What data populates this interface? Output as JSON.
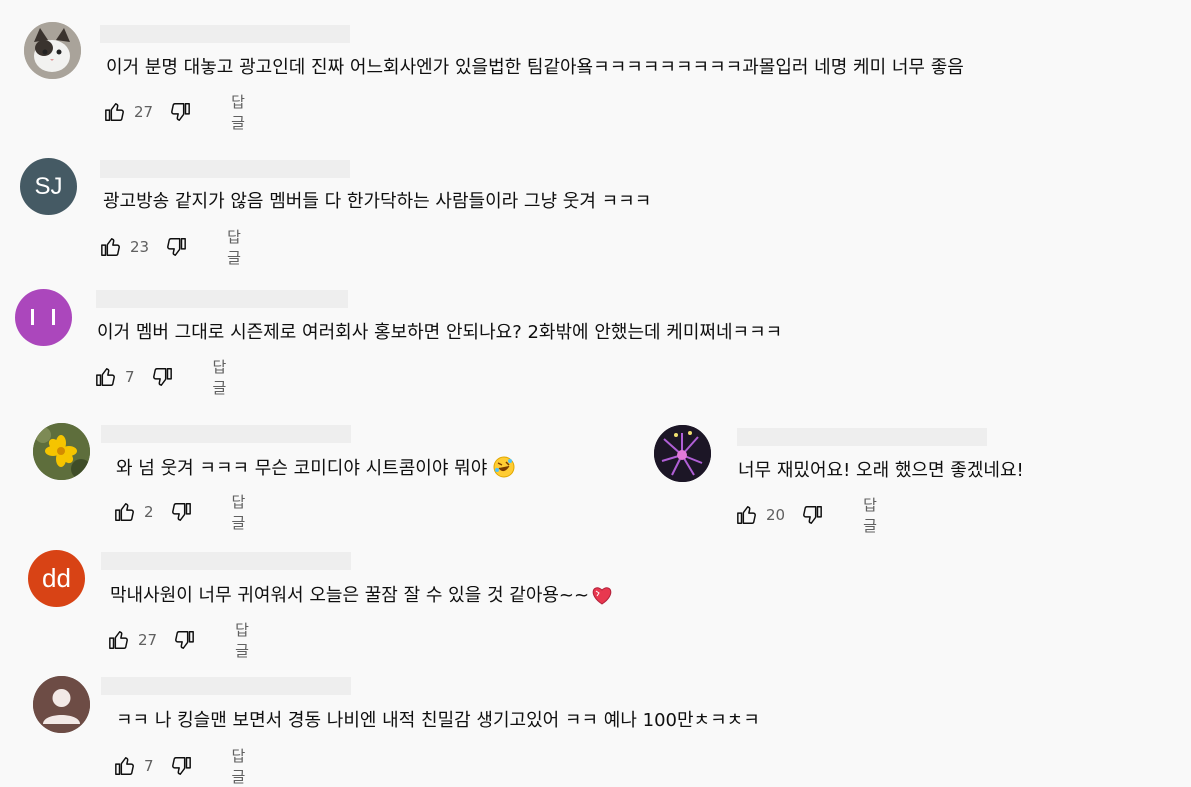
{
  "reply_label": "답글",
  "comments": [
    {
      "text": "이거 분명 대놓고 광고인데 진짜 어느회사엔가 있을법한 팀같아욬ㅋㅋㅋㅋㅋㅋㅋㅋㅋ과몰입러 네명 케미 너무 좋음",
      "likes": "27",
      "avatar": "cat-photo"
    },
    {
      "text": "광고방송 같지가 않음 멤버들 다 한가닥하는 사람들이라 그냥 웃겨 ㅋㅋㅋ",
      "likes": "23",
      "avatar_initials": "SJ",
      "avatar_color": "#455a64"
    },
    {
      "text": "이거 멤버 그대로 시즌제로 여러회사 홍보하면 안되나요?  2화밖에 안했는데 케미쩌네ㅋㅋㅋ",
      "likes": "7",
      "avatar_color": "#ab47bc"
    },
    {
      "text": "와 넘 웃겨 ㅋㅋㅋ 무슨 코미디야 시트콤이야 뭐야",
      "likes": "2",
      "avatar": "flower-photo",
      "emoji": "rofl"
    },
    {
      "text": "너무 재밌어요! 오래 했으면 좋겠네요!",
      "likes": "20",
      "avatar": "purple-flower-photo"
    },
    {
      "text": "막내사원이 너무 귀여워서 오늘은 꿀잠 잘 수 있을 것 같아용~~",
      "likes": "27",
      "avatar_initials": "dd",
      "avatar_color": "#d84315",
      "emoji": "heart"
    },
    {
      "text": "ㅋㅋ 나 킹슬맨 보면서 경동 나비엔 내적 친밀감 생기고있어 ㅋㅋ 예나 100만ㅊㅋㅊㅋ",
      "likes": "7",
      "avatar": "default-person"
    }
  ]
}
